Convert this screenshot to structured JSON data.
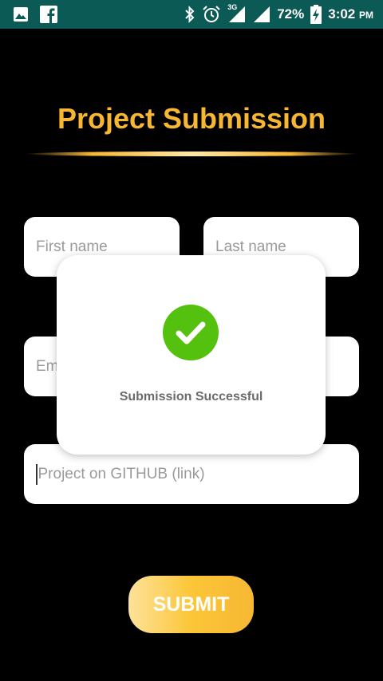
{
  "status_bar": {
    "battery": "72%",
    "time": "3:02",
    "am_pm": "PM",
    "network": "3G",
    "icons": [
      "gallery-icon",
      "facebook-icon",
      "bluetooth-icon",
      "alarm-icon",
      "signal-icon",
      "battery-charging-icon"
    ]
  },
  "page": {
    "title": "Project Submission"
  },
  "form": {
    "first_name_placeholder": "First name",
    "last_name_placeholder": "Last name",
    "email_placeholder_visible": "Em",
    "github_placeholder": "Project on GITHUB (link)",
    "submit_label": "SUBMIT"
  },
  "dialog": {
    "message": "Submission Successful",
    "icon": "check-circle-icon"
  },
  "colors": {
    "status_bar_bg": "#0c5a55",
    "accent": "#f7b733",
    "success": "#54c10f",
    "background": "#000000"
  }
}
